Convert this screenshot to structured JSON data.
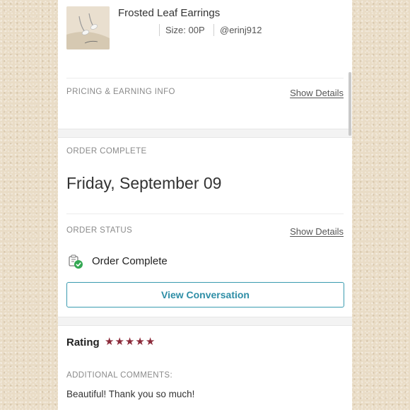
{
  "item": {
    "title": "Frosted Leaf Earrings",
    "size": "Size: 00P",
    "seller": "@erinj912",
    "image_icon": "earrings-thumbnail"
  },
  "pricing": {
    "heading": "PRICING & EARNING INFO",
    "show_details": "Show Details"
  },
  "order_complete": {
    "heading": "ORDER COMPLETE",
    "date": "Friday, September 09"
  },
  "order_status": {
    "heading": "ORDER STATUS",
    "show_details": "Show Details",
    "status_icon": "order-complete-check-icon",
    "status_text": "Order Complete",
    "button_label": "View Conversation"
  },
  "rating": {
    "label": "Rating",
    "stars": 5,
    "star_color": "#8b2a3a",
    "comments_heading": "ADDITIONAL COMMENTS:",
    "comment": "Beautiful! Thank you so much!"
  },
  "colors": {
    "accent": "#2e8ea6",
    "background": "#e9dcc6"
  }
}
